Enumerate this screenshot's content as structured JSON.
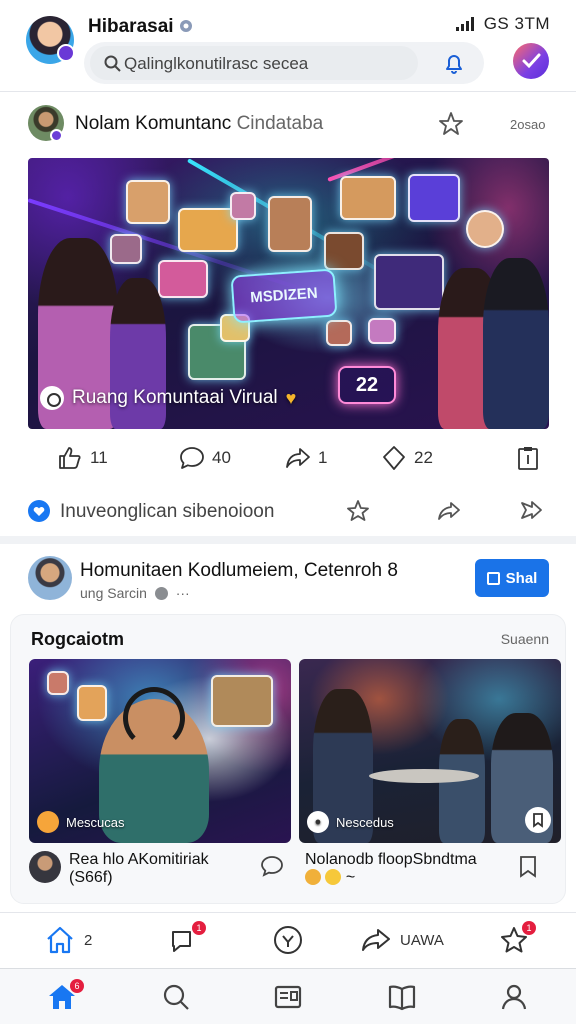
{
  "header": {
    "title": "Hibarasai",
    "status": "GS 3TM",
    "search_placeholder": "Qalinglkonutilrasc secea"
  },
  "post": {
    "author": "Nolam Komuntanc",
    "author_suffix": "Cindataba",
    "time": "2osao",
    "image_sign": "MSDIZEN",
    "image_badge": "22",
    "caption": "Ruang Komuntaai Virual",
    "reactions": {
      "likes": "11",
      "comments": "40",
      "shares": "1",
      "saves": "22"
    }
  },
  "related": {
    "text": "Inuveonglican sibenoioon"
  },
  "community": {
    "name": "Homunitaen Kodlumeiem, Cetenroh",
    "name_suffix": "8",
    "subtitle": "ung Sarcin",
    "dots": "···",
    "join_label": "Shal"
  },
  "suggestions": {
    "title": "Rogcaiotm",
    "more": "Suaenn",
    "cards": [
      {
        "label": "Mescucas",
        "caption_line1": "Rea hlo AKomitiriak",
        "caption_line2": "(S66f)"
      },
      {
        "label": "Nescedus",
        "caption_line1": "Nolanodb floopSbndtma",
        "caption_line2": "~"
      }
    ]
  },
  "action_bar": {
    "home_count": "2",
    "share_label": "UAWA",
    "chat_badge": "1",
    "star_badge": "1"
  },
  "bottom_nav": {
    "home_badge": "6"
  },
  "colors": {
    "accent": "#1877f2",
    "badge": "#e41e3f",
    "join_button": "#1a73e8"
  }
}
